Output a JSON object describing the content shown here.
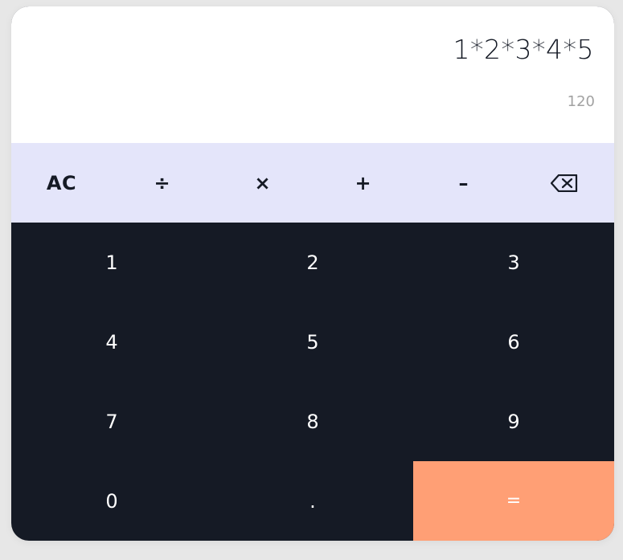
{
  "display": {
    "expression": "1*2*3*4*5",
    "result": "120"
  },
  "operators": {
    "clear": "AC",
    "divide": "÷",
    "multiply": "×",
    "add": "+",
    "subtract": "–",
    "backspace_icon": "backspace-icon"
  },
  "keypad": {
    "rows": [
      [
        "1",
        "2",
        "3"
      ],
      [
        "4",
        "5",
        "6"
      ],
      [
        "7",
        "8",
        "9"
      ],
      [
        "0",
        ".",
        "="
      ]
    ]
  },
  "colors": {
    "display_bg": "#ffffff",
    "operators_bg": "#e4e5fa",
    "keypad_bg": "#151a25",
    "equals_bg": "#ff9f75",
    "result_text": "#a2a2a2"
  }
}
